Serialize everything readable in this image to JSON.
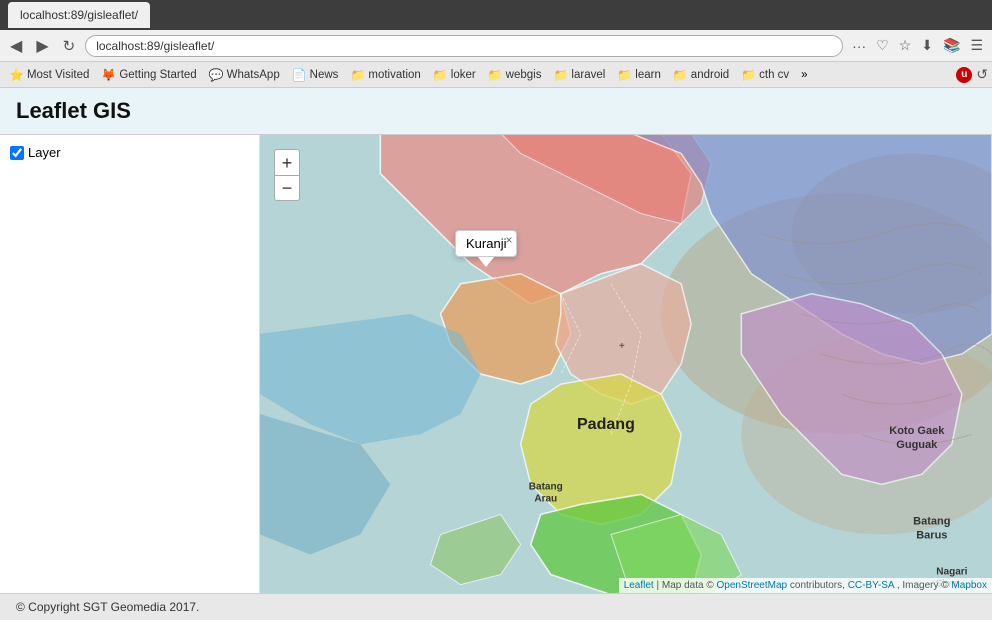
{
  "browser": {
    "tab_title": "localhost:89/gisleaflet/",
    "url": "localhost:89/gisleaflet/",
    "nav_back": "◀",
    "nav_forward": "▶",
    "nav_reload": "↺",
    "bookmarks": [
      {
        "label": "Most Visited",
        "icon": "⭐",
        "type": "special"
      },
      {
        "label": "Getting Started",
        "icon": "🦊",
        "type": "bookmark"
      },
      {
        "label": "WhatsApp",
        "icon": "💬",
        "type": "bookmark"
      },
      {
        "label": "News",
        "icon": "📄",
        "type": "bookmark"
      },
      {
        "label": "motivation",
        "icon": "📁",
        "type": "bookmark"
      },
      {
        "label": "loker",
        "icon": "📁",
        "type": "bookmark"
      },
      {
        "label": "webgis",
        "icon": "📁",
        "type": "bookmark"
      },
      {
        "label": "laravel",
        "icon": "📁",
        "type": "bookmark"
      },
      {
        "label": "learn",
        "icon": "📁",
        "type": "bookmark"
      },
      {
        "label": "android",
        "icon": "📁",
        "type": "bookmark"
      },
      {
        "label": "cth cv",
        "icon": "📁",
        "type": "bookmark"
      }
    ],
    "more_label": "»"
  },
  "page": {
    "title": "Leaflet GIS",
    "layer_label": "Layer",
    "layer_checked": true,
    "popup_text": "Kuranji",
    "popup_close": "×",
    "zoom_in": "+",
    "zoom_out": "−",
    "map_label_padang": "Padang",
    "map_label_batang_arau": "Batang\nArau",
    "map_label_koto_gaek": "Koto Gaek\nGuguak",
    "map_label_batang_barus": "Batang\nBarus",
    "map_label_nagari_simp": "Nagari\nSimp...",
    "attribution_text": "Leaflet | Map data © OpenStreetMap contributors, CC-BY-SA, Imagery © Mapbox",
    "footer_text": "© Copyright SGT Geomedia 2017."
  }
}
